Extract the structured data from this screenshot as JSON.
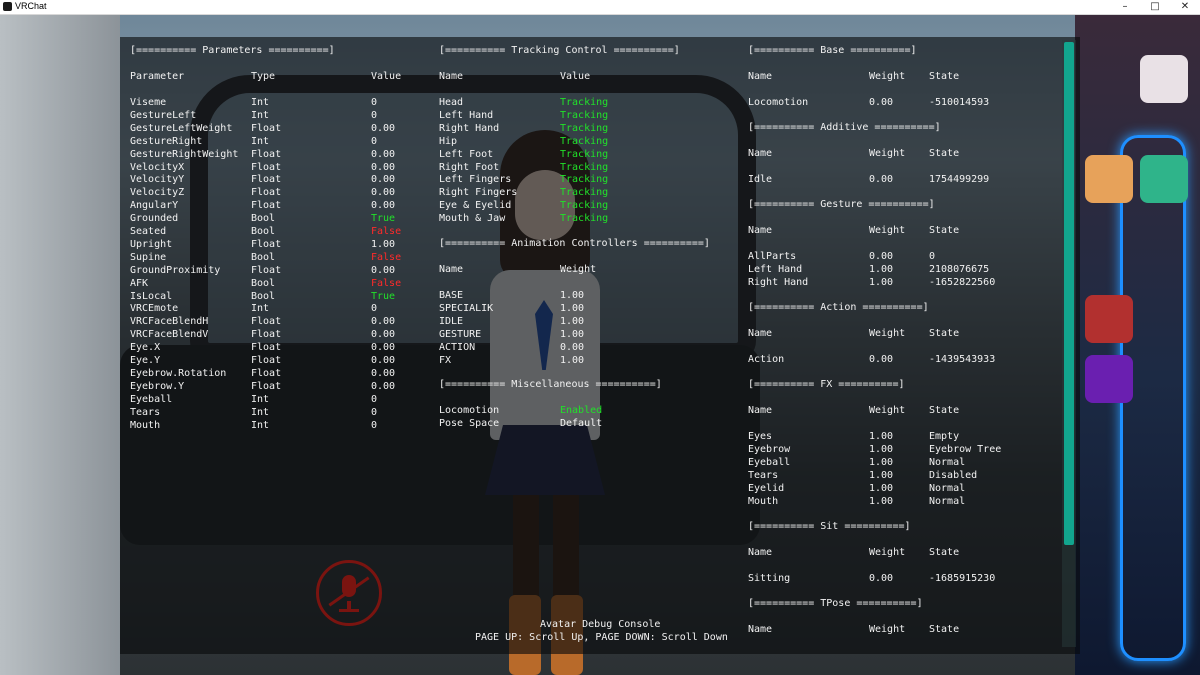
{
  "window": {
    "title": "VRChat",
    "minimize": "–",
    "maximize": "□",
    "close": "✕"
  },
  "parameters": {
    "header": "[========== Parameters ==========]",
    "columns": [
      "Parameter",
      "Type",
      "Value"
    ],
    "rows": [
      {
        "name": "Viseme",
        "type": "Int",
        "value": "0",
        "color": "white"
      },
      {
        "name": "GestureLeft",
        "type": "Int",
        "value": "0",
        "color": "white"
      },
      {
        "name": "GestureLeftWeight",
        "type": "Float",
        "value": "0.00",
        "color": "white"
      },
      {
        "name": "GestureRight",
        "type": "Int",
        "value": "0",
        "color": "white"
      },
      {
        "name": "GestureRightWeight",
        "type": "Float",
        "value": "0.00",
        "color": "white"
      },
      {
        "name": "VelocityX",
        "type": "Float",
        "value": "0.00",
        "color": "white"
      },
      {
        "name": "VelocityY",
        "type": "Float",
        "value": "0.00",
        "color": "white"
      },
      {
        "name": "VelocityZ",
        "type": "Float",
        "value": "0.00",
        "color": "white"
      },
      {
        "name": "AngularY",
        "type": "Float",
        "value": "0.00",
        "color": "white"
      },
      {
        "name": "Grounded",
        "type": "Bool",
        "value": "True",
        "color": "green"
      },
      {
        "name": "Seated",
        "type": "Bool",
        "value": "False",
        "color": "red"
      },
      {
        "name": "Upright",
        "type": "Float",
        "value": "1.00",
        "color": "white"
      },
      {
        "name": "Supine",
        "type": "Bool",
        "value": "False",
        "color": "red"
      },
      {
        "name": "GroundProximity",
        "type": "Float",
        "value": "0.00",
        "color": "white"
      },
      {
        "name": "AFK",
        "type": "Bool",
        "value": "False",
        "color": "red"
      },
      {
        "name": "IsLocal",
        "type": "Bool",
        "value": "True",
        "color": "green"
      },
      {
        "name": "VRCEmote",
        "type": "Int",
        "value": "0",
        "color": "white"
      },
      {
        "name": "VRCFaceBlendH",
        "type": "Float",
        "value": "0.00",
        "color": "white"
      },
      {
        "name": "VRCFaceBlendV",
        "type": "Float",
        "value": "0.00",
        "color": "white"
      },
      {
        "name": "Eye.X",
        "type": "Float",
        "value": "0.00",
        "color": "white"
      },
      {
        "name": "Eye.Y",
        "type": "Float",
        "value": "0.00",
        "color": "white"
      },
      {
        "name": "Eyebrow.Rotation",
        "type": "Float",
        "value": "0.00",
        "color": "white"
      },
      {
        "name": "Eyebrow.Y",
        "type": "Float",
        "value": "0.00",
        "color": "white"
      },
      {
        "name": "Eyeball",
        "type": "Int",
        "value": "0",
        "color": "white"
      },
      {
        "name": "Tears",
        "type": "Int",
        "value": "0",
        "color": "white"
      },
      {
        "name": "Mouth",
        "type": "Int",
        "value": "0",
        "color": "white"
      }
    ]
  },
  "tracking": {
    "header": "[========== Tracking Control ==========]",
    "columns": [
      "Name",
      "Value"
    ],
    "rows": [
      {
        "name": "Head",
        "value": "Tracking"
      },
      {
        "name": "Left Hand",
        "value": "Tracking"
      },
      {
        "name": "Right Hand",
        "value": "Tracking"
      },
      {
        "name": "Hip",
        "value": "Tracking"
      },
      {
        "name": "Left Foot",
        "value": "Tracking"
      },
      {
        "name": "Right Foot",
        "value": "Tracking"
      },
      {
        "name": "Left Fingers",
        "value": "Tracking"
      },
      {
        "name": "Right Fingers",
        "value": "Tracking"
      },
      {
        "name": "Eye & Eyelid",
        "value": "Tracking"
      },
      {
        "name": "Mouth & Jaw",
        "value": "Tracking"
      }
    ]
  },
  "animation_controllers": {
    "header": "[========== Animation Controllers ==========]",
    "columns": [
      "Name",
      "Weight"
    ],
    "rows": [
      {
        "name": "BASE",
        "weight": "1.00"
      },
      {
        "name": "SPECIALIK",
        "weight": "1.00"
      },
      {
        "name": "IDLE",
        "weight": "1.00"
      },
      {
        "name": "GESTURE",
        "weight": "1.00"
      },
      {
        "name": "ACTION",
        "weight": "0.00"
      },
      {
        "name": "FX",
        "weight": "1.00"
      }
    ]
  },
  "miscellaneous": {
    "header": "[========== Miscellaneous ==========]",
    "rows": [
      {
        "name": "Locomotion",
        "value": "Enabled",
        "color": "green"
      },
      {
        "name": "Pose Space",
        "value": "Default",
        "color": "white"
      }
    ]
  },
  "layers": {
    "columns": [
      "Name",
      "Weight",
      "State"
    ],
    "sections": [
      {
        "header": "[========== Base ==========]",
        "rows": [
          {
            "name": "Locomotion",
            "weight": "0.00",
            "state": "-510014593"
          }
        ]
      },
      {
        "header": "[========== Additive ==========]",
        "rows": [
          {
            "name": "Idle",
            "weight": "0.00",
            "state": "1754499299"
          }
        ]
      },
      {
        "header": "[========== Gesture ==========]",
        "rows": [
          {
            "name": "AllParts",
            "weight": "0.00",
            "state": "0"
          },
          {
            "name": "Left Hand",
            "weight": "1.00",
            "state": "2108076675"
          },
          {
            "name": "Right Hand",
            "weight": "1.00",
            "state": "-1652822560"
          }
        ]
      },
      {
        "header": "[========== Action ==========]",
        "rows": [
          {
            "name": "Action",
            "weight": "0.00",
            "state": "-1439543933"
          }
        ]
      },
      {
        "header": "[========== FX ==========]",
        "rows": [
          {
            "name": "Eyes",
            "weight": "1.00",
            "state": "Empty"
          },
          {
            "name": "Eyebrow",
            "weight": "1.00",
            "state": "Eyebrow Tree"
          },
          {
            "name": "Eyeball",
            "weight": "1.00",
            "state": "Normal"
          },
          {
            "name": "Tears",
            "weight": "1.00",
            "state": "Disabled"
          },
          {
            "name": "Eyelid",
            "weight": "1.00",
            "state": "Normal"
          },
          {
            "name": "Mouth",
            "weight": "1.00",
            "state": "Normal"
          }
        ]
      },
      {
        "header": "[========== Sit ==========]",
        "rows": [
          {
            "name": "Sitting",
            "weight": "0.00",
            "state": "-1685915230"
          }
        ]
      },
      {
        "header": "[========== TPose ==========]",
        "rows": []
      }
    ]
  },
  "footer": {
    "title": "Avatar Debug Console",
    "hint": "PAGE UP: Scroll Up, PAGE DOWN: Scroll Down"
  },
  "colors": {
    "tracking_green": "#21e02a",
    "false_red": "#ff2a2a",
    "scrollbar": "#12a58e",
    "mic_muted": "#7a1410"
  },
  "icons": {
    "mic": "microphone-muted-icon"
  }
}
